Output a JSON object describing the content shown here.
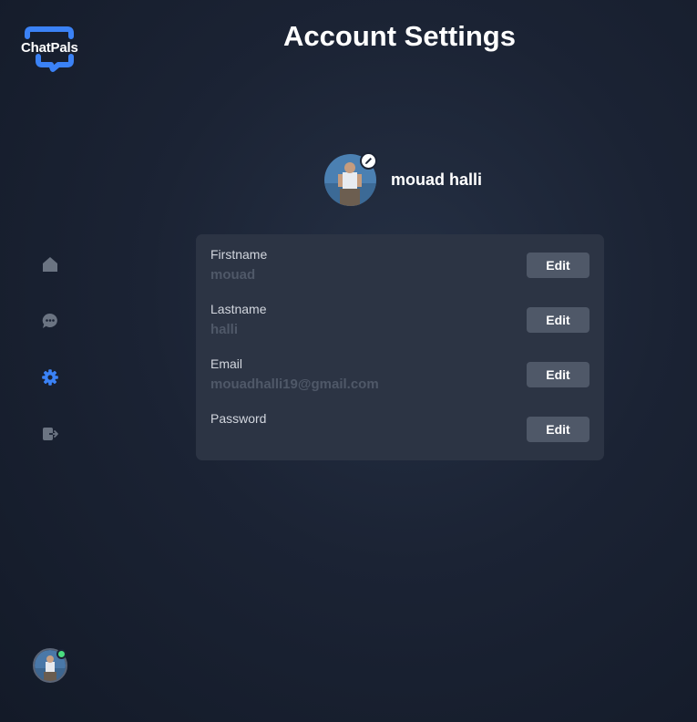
{
  "app": {
    "logo_text": "ChatPals"
  },
  "page": {
    "title": "Account Settings"
  },
  "sidebar": {
    "items": [
      {
        "name": "home",
        "icon": "home-icon",
        "active": false
      },
      {
        "name": "chats",
        "icon": "chat-icon",
        "active": false
      },
      {
        "name": "settings",
        "icon": "gear-icon",
        "active": true
      },
      {
        "name": "logout",
        "icon": "logout-icon",
        "active": false
      }
    ],
    "user_status": "online"
  },
  "profile": {
    "name": "mouad halli"
  },
  "fields": [
    {
      "label": "Firstname",
      "value": "mouad",
      "button": "Edit"
    },
    {
      "label": "Lastname",
      "value": "halli",
      "button": "Edit"
    },
    {
      "label": "Email",
      "value": "mouadhalli19@gmail.com",
      "button": "Edit"
    },
    {
      "label": "Password",
      "value": "",
      "button": "Edit"
    }
  ],
  "colors": {
    "accent": "#3b82f6",
    "icon_inactive": "#6b7482",
    "online": "#4ade80",
    "card": "#2c3444",
    "button": "#4f5868"
  }
}
